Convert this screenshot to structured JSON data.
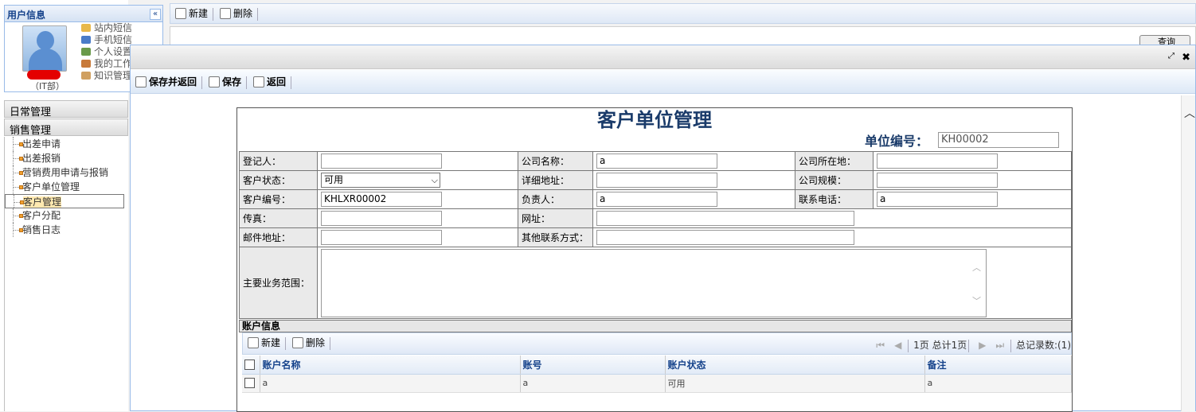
{
  "left": {
    "panel_title": "用户信息",
    "collapse_glyph": "«",
    "department": "（IT部）",
    "user_menu": [
      "站内短信",
      "手机短信",
      "个人设置",
      "我的工作",
      "知识管理"
    ],
    "user_menu_colors": [
      "#e8b84a",
      "#4a7cc8",
      "#6a9a4a",
      "#c87a3a",
      "#d0a060"
    ],
    "sections": [
      "日常管理",
      "销售管理"
    ],
    "tree": [
      "出差申请",
      "出差报销",
      "营销费用申请与报销",
      "客户单位管理",
      "客户管理",
      "客户分配",
      "销售日志"
    ],
    "selected_index": 4
  },
  "main_toolbar": {
    "new": "新建",
    "delete": "删除",
    "query": "查询"
  },
  "modal": {
    "restore_glyph": "⤢",
    "close_glyph": "✖",
    "toolbar": {
      "save_return": "保存并返回",
      "save": "保存",
      "back": "返回"
    },
    "scroll_up": "︿"
  },
  "form": {
    "title": "客户单位管理",
    "unit_no_label": "单位编号：",
    "unit_no_value": "KH00002",
    "rows": [
      [
        {
          "label": "登记人：",
          "value": ""
        },
        {
          "label": "公司名称：",
          "value": "a"
        },
        {
          "label": "公司所在地：",
          "value": ""
        }
      ],
      [
        {
          "label": "客户状态：",
          "value": "可用"
        },
        {
          "label": "详细地址：",
          "value": ""
        },
        {
          "label": "公司规模：",
          "value": ""
        }
      ],
      [
        {
          "label": "客户编号：",
          "value": "KHLXR00002"
        },
        {
          "label": "负责人：",
          "value": "a"
        },
        {
          "label": "联系电话：",
          "value": "a"
        }
      ],
      [
        {
          "label": "传真：",
          "value": ""
        },
        {
          "label": "网址：",
          "value": ""
        }
      ],
      [
        {
          "label": "邮件地址：",
          "value": ""
        },
        {
          "label": "其他联系方式：",
          "value": ""
        }
      ]
    ],
    "business_scope_label": "主要业务范围：",
    "business_scope_value": "",
    "select_arrow": "⌵"
  },
  "account": {
    "section_title": "账户信息",
    "toolbar": {
      "new": "新建",
      "delete": "删除"
    },
    "pager": {
      "first": "⏮",
      "prev": "◀",
      "page_text": "1页 总计1页",
      "next": "▶",
      "last": "⏭",
      "total": "总记录数:(1)"
    },
    "columns": [
      "账户名称",
      "账号",
      "账户状态",
      "备注"
    ],
    "rows": [
      [
        "a",
        "a",
        "可用",
        "a"
      ]
    ]
  }
}
